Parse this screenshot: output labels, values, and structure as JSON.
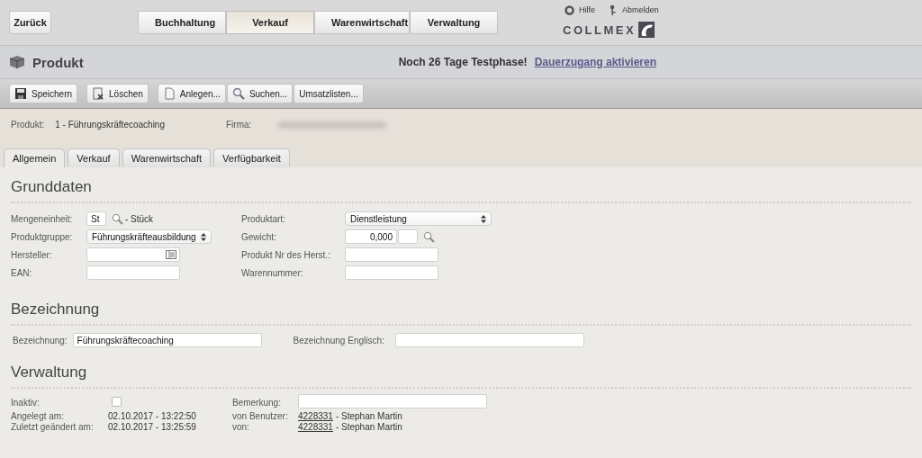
{
  "top_bar": {
    "back_button": "Zurück",
    "modules": [
      {
        "label": "Buchhaltung",
        "selected": false
      },
      {
        "label": "Verkauf",
        "selected": true
      },
      {
        "label": "Warenwirtschaft",
        "selected": false
      },
      {
        "label": "Verwaltung",
        "selected": false
      }
    ],
    "help": "Hilfe",
    "logout": "Abmelden",
    "logo": "COLLMEX"
  },
  "title_bar": {
    "title": "Produkt",
    "trial_notice": "Noch 26 Tage Testphase!",
    "trial_link": "Dauerzugang aktivieren"
  },
  "toolbar": [
    {
      "label": "Speichern"
    },
    {
      "label": "Löschen"
    },
    {
      "label": "Anlegen..."
    },
    {
      "label": "Suchen..."
    },
    {
      "label": "Umsatzlisten..."
    }
  ],
  "header_info": {
    "product_label": "Produkt:",
    "product_value": "1 - Führungskräftecoaching",
    "company_label": "Firma:",
    "company_redacted": true
  },
  "tabs": [
    {
      "label": "Allgemein",
      "selected": true
    },
    {
      "label": "Verkauf",
      "selected": false
    },
    {
      "label": "Warenwirtschaft",
      "selected": false
    },
    {
      "label": "Verfügbarkeit",
      "selected": false
    }
  ],
  "grunddaten": {
    "title": "Grunddaten",
    "left": [
      {
        "label": "Mengeneinheit:",
        "kind": "lookup",
        "value": "St",
        "suffix": "- Stück"
      },
      {
        "label": "Produktgruppe:",
        "kind": "select",
        "value": "Führungskräfteausbildung"
      },
      {
        "label": "Hersteller:",
        "kind": "picker"
      },
      {
        "label": "EAN:",
        "kind": "text"
      }
    ],
    "right": [
      {
        "label": "Produktart:",
        "kind": "select",
        "value": "Dienstleistung"
      },
      {
        "label": "Gewicht:",
        "kind": "number",
        "value": "0,000"
      },
      {
        "label": "Produkt Nr des Herst.:",
        "kind": "text"
      },
      {
        "label": "Warennummer:",
        "kind": "text"
      }
    ]
  },
  "bezeichnung": {
    "title": "Bezeichnung",
    "name_label": "Bezeichnung:",
    "name_value": "Führungskräftecoaching",
    "english_label": "Bezeichnung Englisch:"
  },
  "verwaltung": {
    "title": "Verwaltung",
    "inactive_label": "Inaktiv:",
    "inactive_checked": false,
    "remark_label": "Bemerkung:",
    "rows": [
      {
        "label": "Angelegt am:",
        "value": "02.10.2017 - 13:22:50",
        "user_label": "von Benutzer:",
        "user_id": "4228331",
        "user_name": "- Stephan Martin"
      },
      {
        "label": "Zuletzt geändert am:",
        "value": "02.10.2017 - 13:25:59",
        "user_label": "von:",
        "user_id": "4228331",
        "user_name": "- Stephan Martin"
      }
    ]
  }
}
